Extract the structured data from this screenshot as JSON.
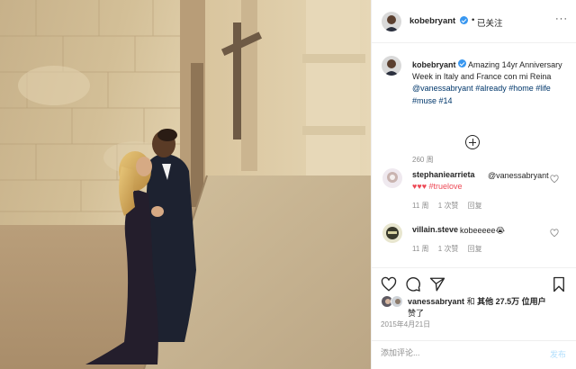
{
  "post": {
    "username": "kobebryant",
    "follow_status": "已关注",
    "separator": "•",
    "more_label": "···"
  },
  "caption": {
    "username": "kobebryant",
    "text": "Amazing 14yr Anniversary Week in Italy and France con mi Reina",
    "mention": "@vanessabryant",
    "hashtags": "#already #home #life #muse #14",
    "time": "260 周"
  },
  "comments": [
    {
      "username": "stephaniearrieta",
      "mention": "@vanessabryant",
      "text": "♥♥♥ #truelove",
      "time": "11 周",
      "likes": "1 次赞",
      "reply": "回复"
    },
    {
      "username": "villain.steve",
      "text": "kobeeeee😭",
      "time": "11 周",
      "likes": "1 次赞",
      "reply": "回复"
    }
  ],
  "likes": {
    "first_user": "vanessabryant",
    "and": "和",
    "others": "其他",
    "count": "27.5万",
    "suffix": "位用户",
    "liked": "赞了"
  },
  "date": "2015年4月21日",
  "comment_box": {
    "placeholder": "添加评论...",
    "post_label": "发布"
  },
  "icons": {
    "like": "heart-icon",
    "comment": "comment-icon",
    "share": "paper-plane-icon",
    "save": "bookmark-icon",
    "load_more": "plus-circle-icon",
    "verified": "verified-badge-icon"
  },
  "colors": {
    "verified": "#3897f0",
    "hashtag": "#00376b",
    "heart": "#ed4956",
    "post_button_disabled": "#b2dffc",
    "muted_text": "#8e8e8e"
  }
}
